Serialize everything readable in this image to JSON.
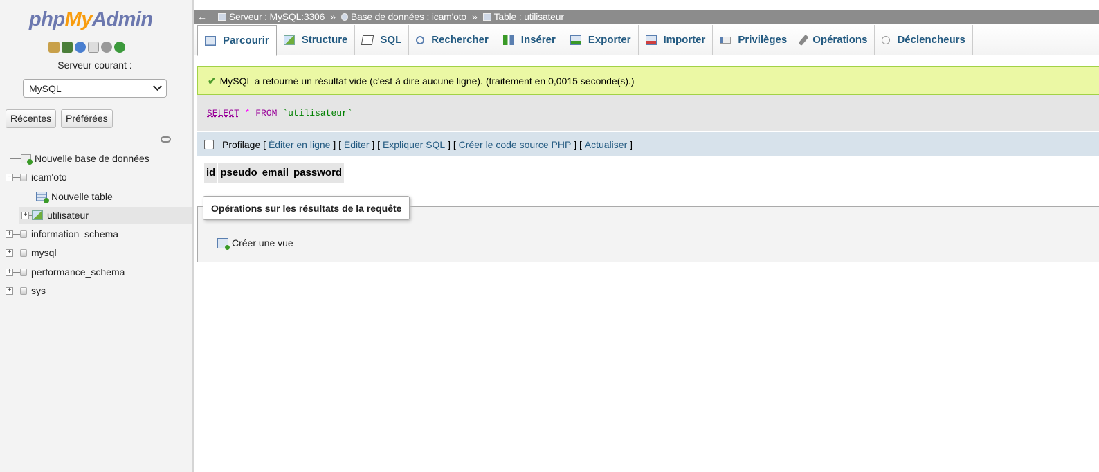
{
  "app": {
    "logo_php": "php",
    "logo_my": "My",
    "logo_admin": "Admin"
  },
  "sidebar": {
    "server_label": "Serveur courant :",
    "server_select": "MySQL",
    "recent_tab": "Récentes",
    "favorites_tab": "Préférées",
    "tree": {
      "new_db": "Nouvelle base de données",
      "db1": "icam'oto",
      "new_table": "Nouvelle table",
      "table1": "utilisateur",
      "db2": "information_schema",
      "db3": "mysql",
      "db4": "performance_schema",
      "db5": "sys"
    }
  },
  "breadcrumb": {
    "back": "←",
    "server": "Serveur : MySQL:3306",
    "sep": "»",
    "database": "Base de données : icam'oto",
    "table": "Table : utilisateur"
  },
  "tabs": {
    "browse": "Parcourir",
    "structure": "Structure",
    "sql": "SQL",
    "search": "Rechercher",
    "insert": "Insérer",
    "export": "Exporter",
    "import": "Importer",
    "privileges": "Privilèges",
    "operations": "Opérations",
    "triggers": "Déclencheurs"
  },
  "message": {
    "success": "MySQL a retourné un résultat vide (c'est à dire aucune ligne). (traitement en 0,0015 seconde(s).)"
  },
  "query": {
    "select": "SELECT",
    "star": "*",
    "from": "FROM",
    "table": "`utilisateur`"
  },
  "profiling": {
    "label": "Profilage",
    "edit_inline": "Éditer en ligne",
    "edit": "Éditer",
    "explain": "Expliquer SQL",
    "php_code": "Créer le code source PHP",
    "refresh": "Actualiser"
  },
  "results": {
    "columns": [
      "id",
      "pseudo",
      "email",
      "password"
    ]
  },
  "operations": {
    "legend": "Opérations sur les résultats de la requête",
    "create_view": "Créer une vue"
  },
  "colors": {
    "link": "#235a81",
    "success_bg": "#ebf8a4",
    "logo_blue": "#6c78af",
    "logo_orange": "#f89c0e"
  }
}
